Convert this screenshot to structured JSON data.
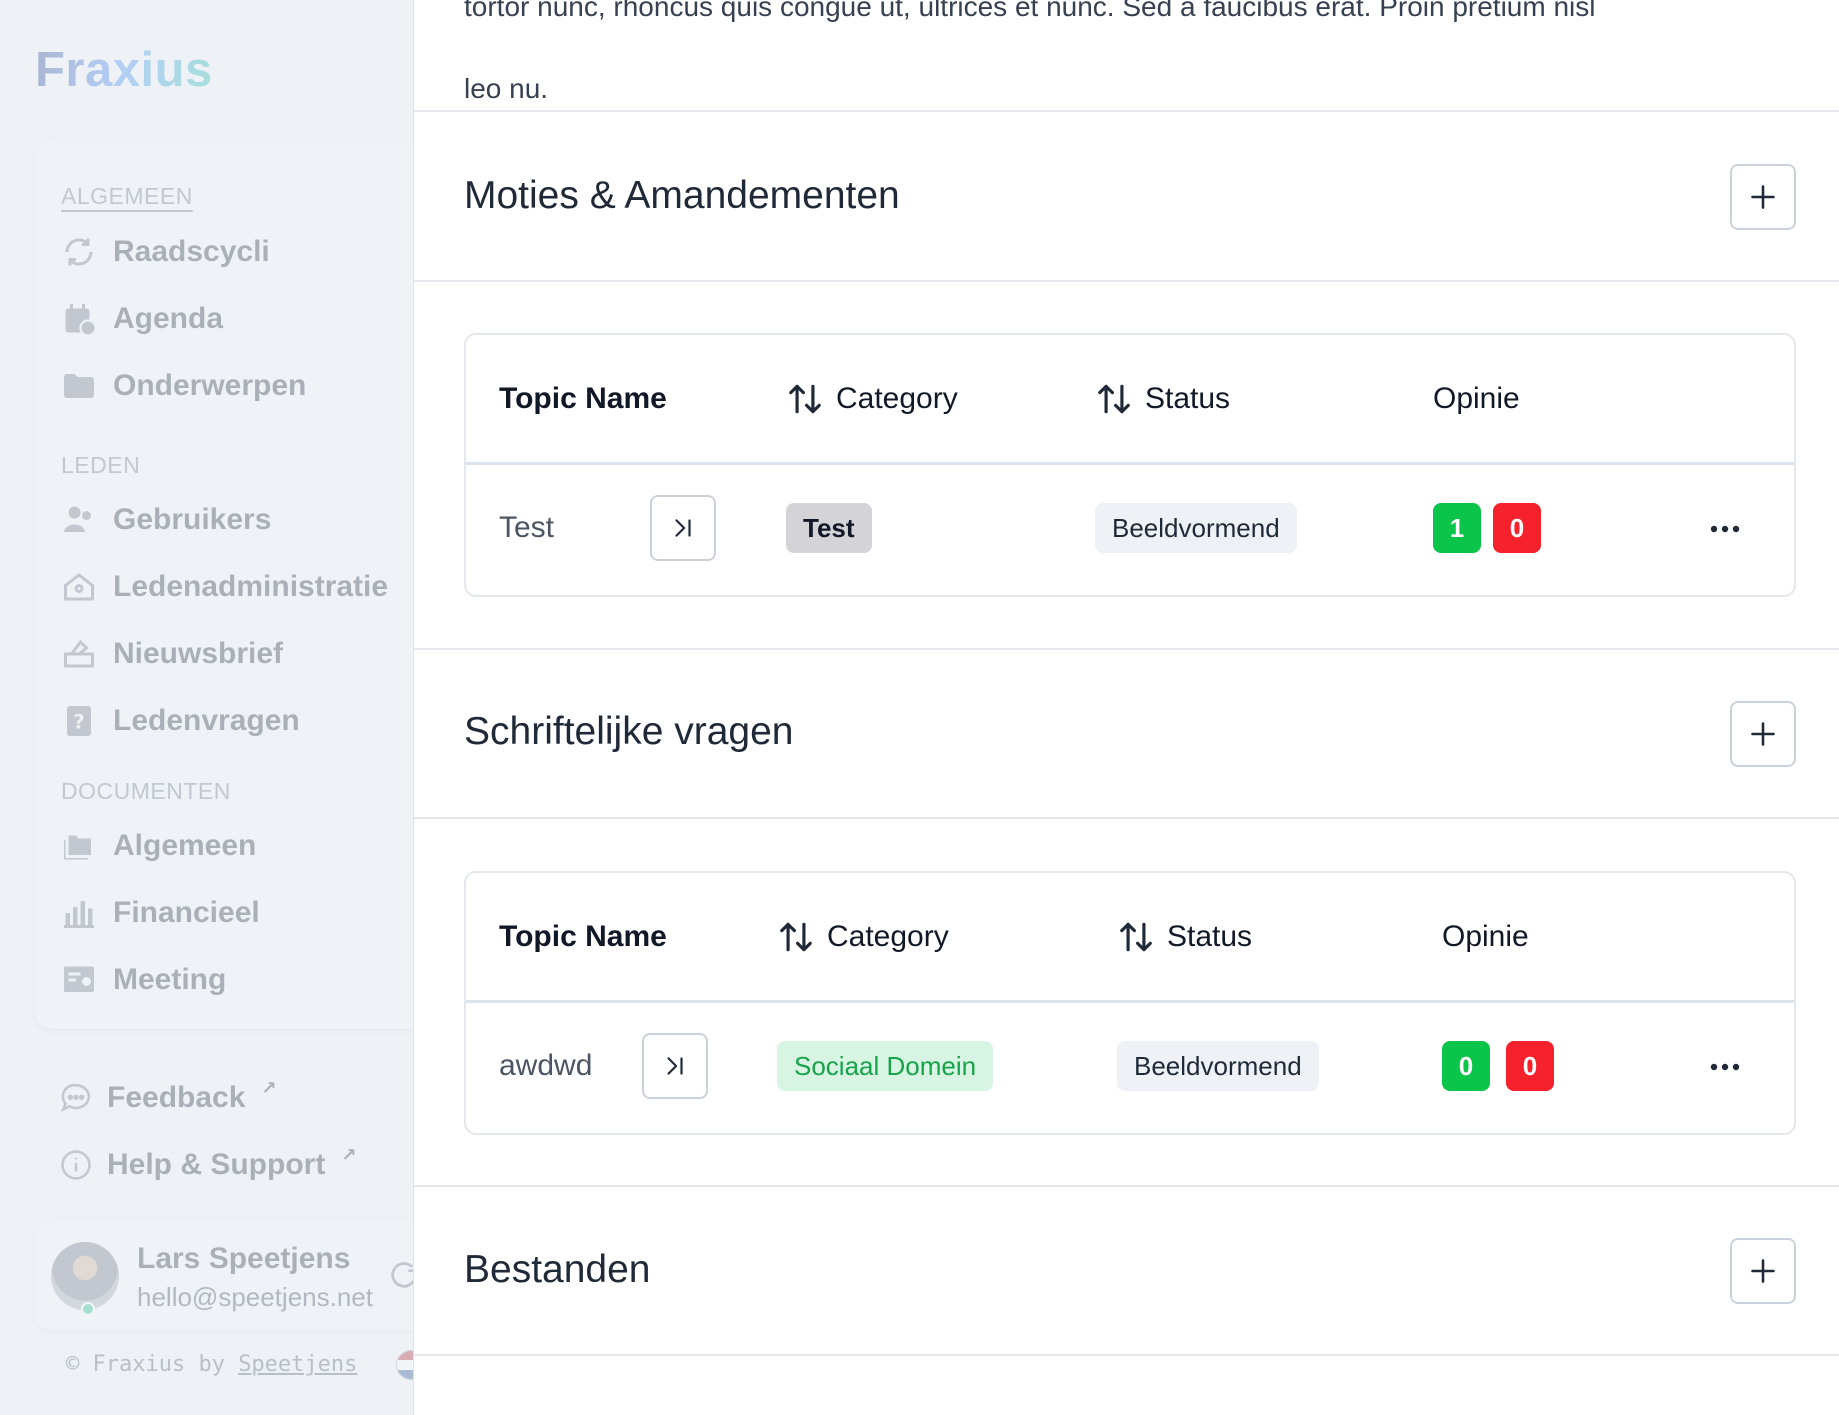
{
  "sidebar": {
    "logo": "Fraxius",
    "sections": {
      "general": "ALGEMEEN",
      "members": "LEDEN",
      "documents": "DOCUMENTEN"
    },
    "items": [
      {
        "label": "Raadscycli",
        "icon": "cycle-icon"
      },
      {
        "label": "Agenda",
        "icon": "calendar-icon"
      },
      {
        "label": "Onderwerpen",
        "icon": "folder-icon"
      },
      {
        "label": "Gebruikers",
        "icon": "users-icon"
      },
      {
        "label": "Ledenadministratie",
        "icon": "house-icon"
      },
      {
        "label": "Nieuwsbrief",
        "icon": "newsletter-icon"
      },
      {
        "label": "Ledenvragen",
        "icon": "question-icon"
      },
      {
        "label": "Algemeen",
        "icon": "folders-icon"
      },
      {
        "label": "Financieel",
        "icon": "bar-chart-icon"
      },
      {
        "label": "Meeting",
        "icon": "presentation-icon"
      }
    ],
    "feedback": "Feedback",
    "help": "Help & Support",
    "user": {
      "name": "Lars Speetjens",
      "email": "hello@speetjens.net"
    },
    "footer": {
      "prefix": "© Fraxius by ",
      "link": "Speetjens"
    }
  },
  "main": {
    "intro_text_top": "tortor nunc, rhoncus quis congue ut, ultrices et nunc. Sed a faucibus erat. Proin pretium nisl",
    "intro_text_bottom": "leo nu.",
    "sections": [
      {
        "title": "Moties & Amandementen",
        "columns": {
          "name": "Topic Name",
          "category": "Category",
          "status": "Status",
          "opinion": "Opinie"
        },
        "rows": [
          {
            "name": "Test",
            "category": "Test",
            "status": "Beeldvormend",
            "votes_up": "1",
            "votes_down": "0"
          }
        ]
      },
      {
        "title": "Schriftelijke vragen",
        "columns": {
          "name": "Topic Name",
          "category": "Category",
          "status": "Status",
          "opinion": "Opinie"
        },
        "rows": [
          {
            "name": "awdwd",
            "category": "Sociaal Domein",
            "status": "Beeldvormend",
            "votes_up": "0",
            "votes_down": "0"
          }
        ]
      },
      {
        "title": "Bestanden"
      }
    ]
  },
  "colors": {
    "vote_up": "#0bc44a",
    "vote_down": "#f5222d",
    "category_green_bg": "#d8f5e4",
    "category_green_text": "#16a34a"
  }
}
